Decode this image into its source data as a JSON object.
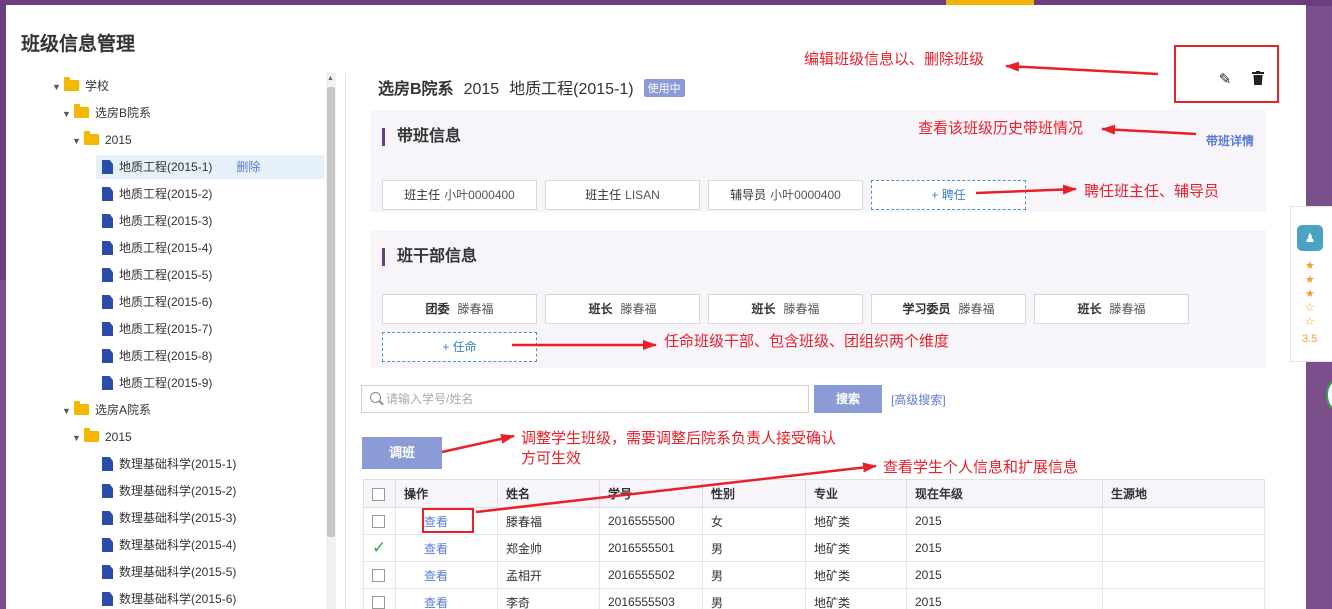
{
  "page_title": "班级信息管理",
  "tree": [
    {
      "label": "学校",
      "type": "folder",
      "arrow": "▼",
      "level": 0
    },
    {
      "label": "选房B院系",
      "type": "folder",
      "arrow": "▼",
      "level": 1
    },
    {
      "label": "2015",
      "type": "folder",
      "arrow": "▼",
      "level": 2
    },
    {
      "label": "地质工程(2015-1)",
      "type": "doc",
      "level": 3,
      "selected": true,
      "action": "删除"
    },
    {
      "label": "地质工程(2015-2)",
      "type": "doc",
      "level": 3
    },
    {
      "label": "地质工程(2015-3)",
      "type": "doc",
      "level": 3
    },
    {
      "label": "地质工程(2015-4)",
      "type": "doc",
      "level": 3
    },
    {
      "label": "地质工程(2015-5)",
      "type": "doc",
      "level": 3
    },
    {
      "label": "地质工程(2015-6)",
      "type": "doc",
      "level": 3
    },
    {
      "label": "地质工程(2015-7)",
      "type": "doc",
      "level": 3
    },
    {
      "label": "地质工程(2015-8)",
      "type": "doc",
      "level": 3
    },
    {
      "label": "地质工程(2015-9)",
      "type": "doc",
      "level": 3
    },
    {
      "label": "选房A院系",
      "type": "folder",
      "arrow": "▼",
      "level": 1
    },
    {
      "label": "2015",
      "type": "folder",
      "arrow": "▼",
      "level": 2
    },
    {
      "label": "数理基础科学(2015-1)",
      "type": "doc",
      "level": 3
    },
    {
      "label": "数理基础科学(2015-2)",
      "type": "doc",
      "level": 3
    },
    {
      "label": "数理基础科学(2015-3)",
      "type": "doc",
      "level": 3
    },
    {
      "label": "数理基础科学(2015-4)",
      "type": "doc",
      "level": 3
    },
    {
      "label": "数理基础科学(2015-5)",
      "type": "doc",
      "level": 3
    },
    {
      "label": "数理基础科学(2015-6)",
      "type": "doc",
      "level": 3
    }
  ],
  "class_header": {
    "department": "选房B院系",
    "year": "2015",
    "class_name": "地质工程(2015-1)",
    "status": "使用中"
  },
  "teacher_section": {
    "title": "带班信息",
    "detail_link": "带班详情",
    "cards": [
      {
        "role": "班主任",
        "name": "小叶0000400"
      },
      {
        "role": "班主任",
        "name": "LISAN"
      },
      {
        "role": "辅导员",
        "name": "小叶0000400"
      }
    ],
    "add_label": "+ 聘任"
  },
  "cadre_section": {
    "title": "班干部信息",
    "cards": [
      {
        "role": "团委",
        "name": "滕春福"
      },
      {
        "role": "班长",
        "name": "滕春福"
      },
      {
        "role": "班长",
        "name": "滕春福"
      },
      {
        "role": "学习委员",
        "name": "滕春福"
      },
      {
        "role": "班长",
        "name": "滕春福"
      }
    ],
    "add_label": "+ 任命"
  },
  "search": {
    "placeholder": "请输入学号/姓名",
    "button": "搜索",
    "advanced": "[高级搜索]"
  },
  "adjust_button": "调班",
  "table": {
    "columns": [
      "操作",
      "姓名",
      "学号",
      "性别",
      "专业",
      "现在年级",
      "生源地"
    ],
    "rows": [
      {
        "checked": false,
        "action": "查看",
        "name": "滕春福",
        "id": "2016555500",
        "gender": "女",
        "major": "地矿类",
        "grade": "2015",
        "origin": ""
      },
      {
        "checked": true,
        "action": "查看",
        "name": "郑金帅",
        "id": "2016555501",
        "gender": "男",
        "major": "地矿类",
        "grade": "2015",
        "origin": ""
      },
      {
        "checked": false,
        "action": "查看",
        "name": "孟相开",
        "id": "2016555502",
        "gender": "男",
        "major": "地矿类",
        "grade": "2015",
        "origin": ""
      },
      {
        "checked": false,
        "action": "查看",
        "name": "李奇",
        "id": "2016555503",
        "gender": "男",
        "major": "地矿类",
        "grade": "2015",
        "origin": ""
      }
    ]
  },
  "annotations": {
    "edit_delete": "编辑班级信息以、删除班级",
    "history": "查看该班级历史带班情况",
    "hire": "聘任班主任、辅导员",
    "appoint": "任命班级干部、包含班级、团组织两个维度",
    "adjust_line1": "调整学生班级，需要调整后院系负责人接受确认",
    "adjust_line2": "方可生效",
    "view": "查看学生个人信息和扩展信息"
  },
  "widget": {
    "rating": "3.5",
    "stars": [
      "★",
      "★",
      "★",
      "☆",
      "☆"
    ]
  },
  "colors": {
    "accent": "#8a9bd6",
    "brand_purple": "#6b3f7f",
    "link": "#5b7bd5",
    "annotation_red": "#e8202a",
    "folder": "#f5b800",
    "doc": "#2b4ca8"
  }
}
